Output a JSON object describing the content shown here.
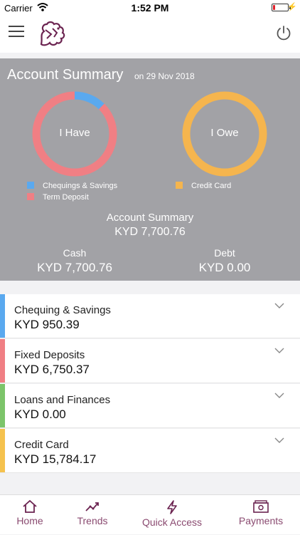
{
  "status": {
    "carrier": "Carrier",
    "time": "1:52 PM"
  },
  "summary": {
    "title": "Account Summary",
    "date": "on 29 Nov 2018",
    "have_label": "I Have",
    "owe_label": "I Owe",
    "legend_have": [
      {
        "label": "Chequings & Savings",
        "color": "#5aa9ef"
      },
      {
        "label": "Term Deposit",
        "color": "#f07f84"
      }
    ],
    "legend_owe": [
      {
        "label": "Credit Card",
        "color": "#f5b54e"
      }
    ],
    "have_chart": {
      "type": "pie",
      "segments": [
        {
          "label": "Chequings & Savings",
          "value": 950.39,
          "color": "#5aa9ef"
        },
        {
          "label": "Term Deposit",
          "value": 6750.37,
          "color": "#f07f84"
        }
      ]
    },
    "owe_chart": {
      "type": "pie",
      "segments": [
        {
          "label": "Credit Card",
          "value": 15784.17,
          "color": "#f5b54e"
        }
      ]
    },
    "total_label": "Account Summary",
    "total_value": "KYD 7,700.76",
    "cash_label": "Cash",
    "cash_value": "KYD 7,700.76",
    "debt_label": "Debt",
    "debt_value": "KYD 0.00"
  },
  "accounts": [
    {
      "name": "Chequing & Savings",
      "amount": "KYD 950.39",
      "color": "#5aa9ef"
    },
    {
      "name": "Fixed Deposits",
      "amount": "KYD 6,750.37",
      "color": "#f07f84"
    },
    {
      "name": "Loans and Finances",
      "amount": "KYD 0.00",
      "color": "#7cc46a"
    },
    {
      "name": "Credit Card",
      "amount": "KYD 15,784.17",
      "color": "#f5c24e"
    }
  ],
  "tabs": [
    {
      "label": "Home",
      "icon": "home-icon"
    },
    {
      "label": "Trends",
      "icon": "trends-icon"
    },
    {
      "label": "Quick Access",
      "icon": "lightning-icon"
    },
    {
      "label": "Payments",
      "icon": "payments-icon"
    }
  ]
}
